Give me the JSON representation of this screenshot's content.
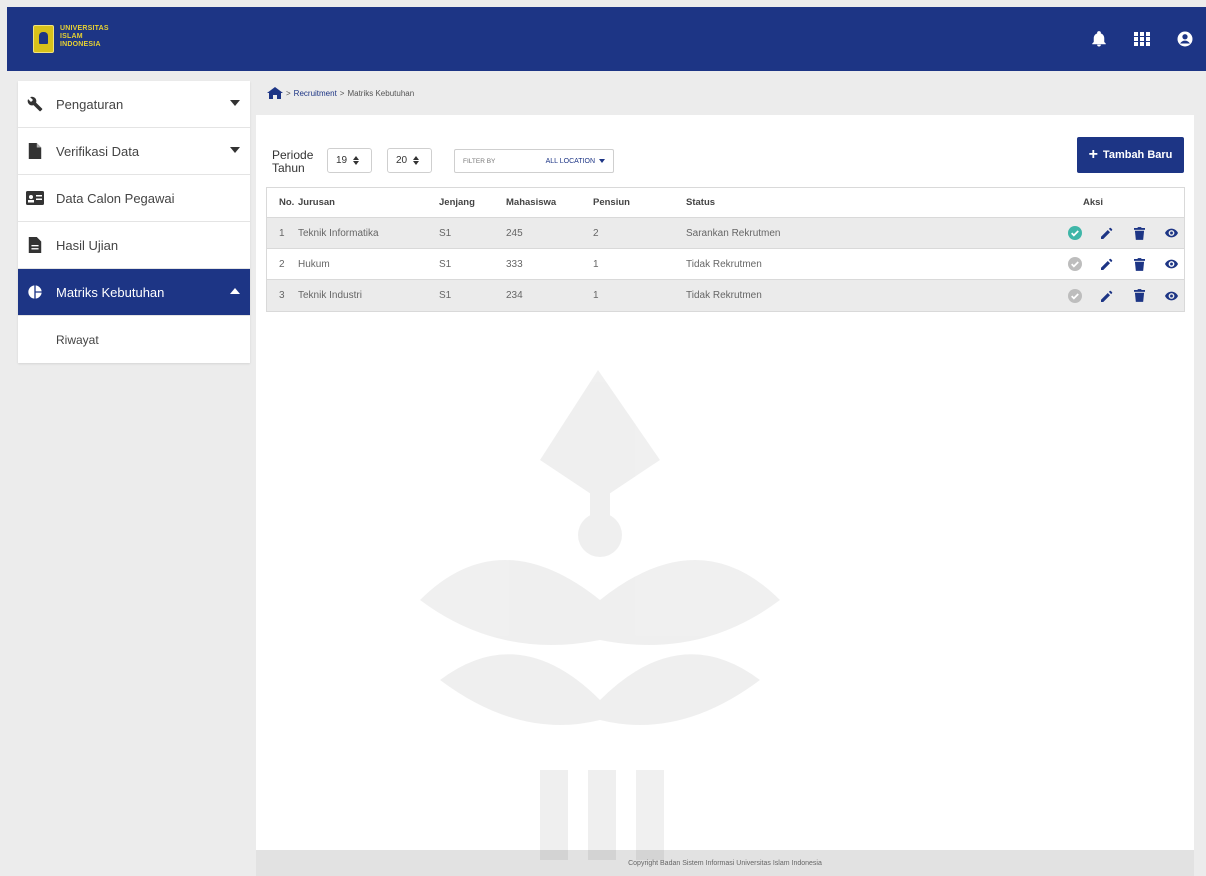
{
  "header": {
    "logo_text": [
      "UNIVERSITAS",
      "ISLAM",
      "INDONESIA"
    ],
    "icons": [
      "bell-icon",
      "apps-grid-icon",
      "user-account-icon"
    ]
  },
  "sidebar": {
    "items": [
      {
        "label": "Pengaturan",
        "icon": "wrench-icon",
        "expandable": true,
        "active": false
      },
      {
        "label": "Verifikasi Data",
        "icon": "file-icon",
        "expandable": true,
        "active": false
      },
      {
        "label": "Data Calon Pegawai",
        "icon": "id-card-icon",
        "expandable": false,
        "active": false
      },
      {
        "label": "Hasil Ujian",
        "icon": "document-icon",
        "expandable": false,
        "active": false
      },
      {
        "label": "Matriks Kebutuhan",
        "icon": "pie-chart-icon",
        "expandable": true,
        "active": true
      }
    ],
    "subitems": [
      {
        "label": "Riwayat"
      }
    ]
  },
  "breadcrumb": {
    "home_icon": "home-icon",
    "sep": ">",
    "link": "Recruitment",
    "current": "Matriks Kebutuhan"
  },
  "toolbar": {
    "periode_label_1": "Periode",
    "periode_label_2": "Tahun",
    "year_from": "19",
    "year_to": "20",
    "filter_label": "FILTER BY",
    "filter_value": "ALL LOCATION",
    "add_label": "Tambah Baru"
  },
  "table": {
    "headers": {
      "no": "No.",
      "jurusan": "Jurusan",
      "jenjang": "Jenjang",
      "mahasiswa": "Mahasiswa",
      "pensiun": "Pensiun",
      "status": "Status",
      "aksi": "Aksi"
    },
    "rows": [
      {
        "no": "1",
        "jurusan": "Teknik Informatika",
        "jenjang": "S1",
        "mahasiswa": "245",
        "pensiun": "2",
        "status": "Sarankan Rekrutmen",
        "checked": true
      },
      {
        "no": "2",
        "jurusan": "Hukum",
        "jenjang": "S1",
        "mahasiswa": "333",
        "pensiun": "1",
        "status": "Tidak Rekrutmen",
        "checked": false
      },
      {
        "no": "3",
        "jurusan": "Teknik Industri",
        "jenjang": "S1",
        "mahasiswa": "234",
        "pensiun": "1",
        "status": "Tidak Rekrutmen",
        "checked": false
      }
    ]
  },
  "footer": {
    "text": "Copyright Badan Sistem Informasi Universitas Islam Indonesia"
  },
  "colors": {
    "primary": "#1d3585",
    "logo_yellow": "#d8c21a",
    "check_teal": "#3fb6a8",
    "check_gray": "#bdbdbd"
  }
}
